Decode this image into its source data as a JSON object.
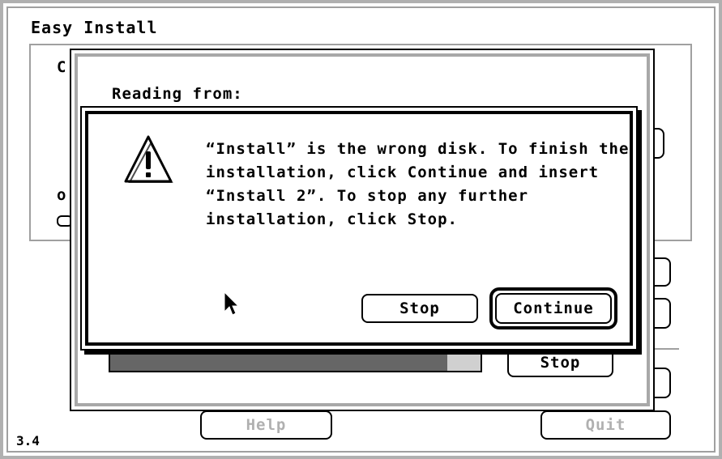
{
  "window": {
    "title": "Easy Install",
    "version": "3.4",
    "help_label": "Help",
    "quit_label": "Quit",
    "hidden_char_1": "C",
    "hidden_char_2": "o"
  },
  "progress": {
    "reading_label": "Reading from:",
    "stop_label": "Stop",
    "fraction": 0.91
  },
  "alert": {
    "icon": "caution-icon",
    "message_lines": [
      "“Install” is the wrong disk.  To finish the",
      "installation, click Continue and insert",
      "“Install 2”.  To stop any further",
      "installation, click Stop."
    ],
    "stop_label": "Stop",
    "continue_label": "Continue"
  },
  "colors": {
    "progress_fill": "#666666",
    "progress_remaining": "#d0d0d0",
    "frame_gray": "#a8a8a8"
  }
}
